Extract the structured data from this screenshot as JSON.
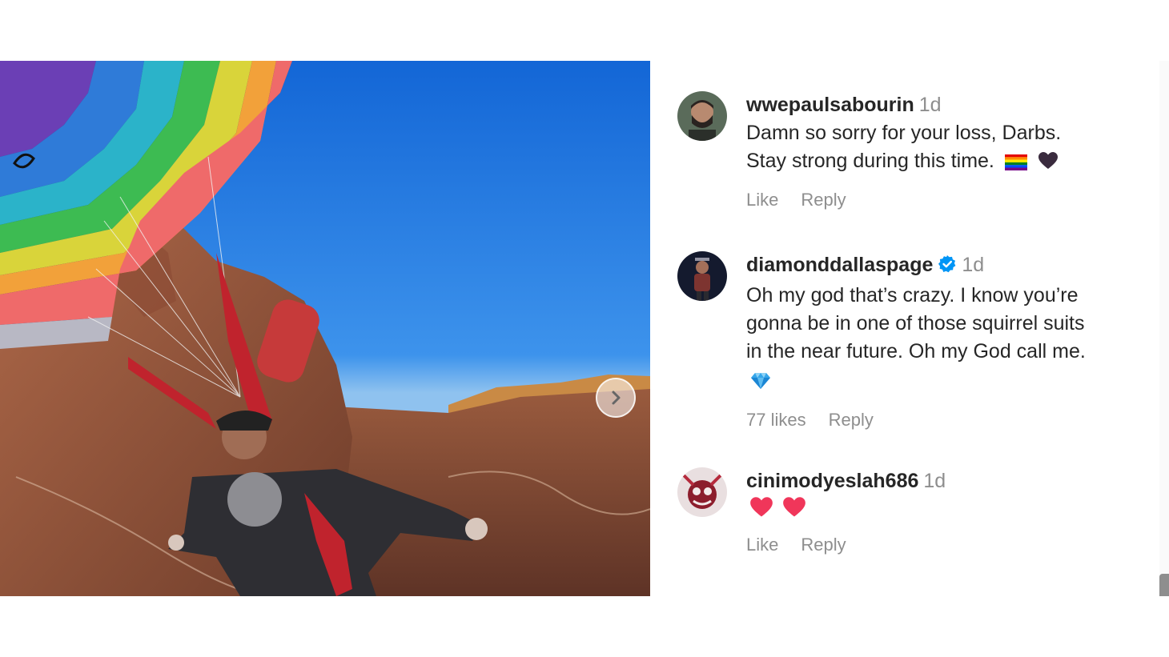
{
  "post": {
    "media": {
      "description_icon": "next-arrow-icon"
    },
    "comments": [
      {
        "username": "wwepaulsabourin",
        "time": "1d",
        "text_line1": "Damn so sorry for your loss, Darbs.",
        "text_line2": "Stay strong during this time.",
        "emojis": [
          "rainbow-flag-icon",
          "black-heart-icon"
        ],
        "actions": {
          "like": "Like",
          "reply": "Reply"
        }
      },
      {
        "username": "diamonddallaspage",
        "verified": true,
        "time": "1d",
        "text_line1": "Oh my god that’s crazy. I know you’re",
        "text_line2": "gonna be in one of those squirrel suits",
        "text_line3": "in the near future. Oh my God call me.",
        "emojis": [
          "gem-icon"
        ],
        "actions": {
          "likes": "77 likes",
          "reply": "Reply"
        }
      },
      {
        "username": "cinimodyeslah686",
        "time": "1d",
        "emojis": [
          "red-heart-icon",
          "red-heart-icon"
        ],
        "actions": {
          "like": "Like",
          "reply": "Reply"
        }
      }
    ]
  },
  "colors": {
    "text": "#262626",
    "muted": "#8e8e8e",
    "verified": "#0095f6",
    "heart": "#f0365a"
  }
}
